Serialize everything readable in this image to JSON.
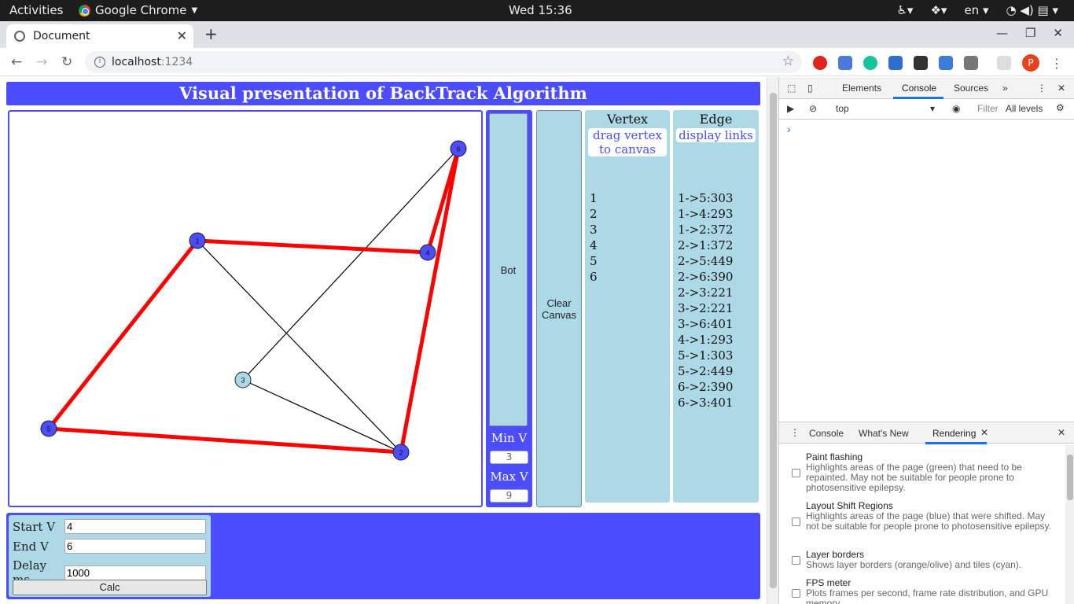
{
  "os": {
    "activities": "Activities",
    "app_name": "Google Chrome",
    "clock": "Wed 15:36",
    "language": "en"
  },
  "browser": {
    "tab_title": "Document",
    "url_host": "localhost",
    "url_port": ":1234",
    "profile_initial": "P"
  },
  "app": {
    "title": "Visual presentation of BackTrack Algorithm",
    "bot_label": "Bot",
    "min_label": "Min V",
    "min_value": "3",
    "max_label": "Max V",
    "max_value": "9",
    "clear_label": "Clear Canvas",
    "vertex_panel": {
      "title": "Vertex",
      "link": "drag vertex to canvas",
      "items": [
        "1",
        "2",
        "3",
        "4",
        "5",
        "6"
      ]
    },
    "edge_panel": {
      "title": "Edge",
      "link": "display links",
      "items": [
        "1->5:303",
        "1->4:293",
        "1->2:372",
        "2->1:372",
        "2->5:449",
        "2->6:390",
        "2->3:221",
        "3->2:221",
        "3->6:401",
        "4->1:293",
        "5->1:303",
        "5->2:449",
        "6->2:390",
        "6->3:401"
      ]
    },
    "form": {
      "start_label": "Start V",
      "start_value": "4",
      "end_label": "End V",
      "end_value": "6",
      "delay_label": "Delay ms",
      "delay_value": "1000",
      "calc_label": "Calc"
    },
    "graph": {
      "nodes": [
        {
          "id": "1",
          "color": "#4b4dff"
        },
        {
          "id": "2",
          "color": "#4b4dff"
        },
        {
          "id": "3",
          "color": "#add8e6"
        },
        {
          "id": "4",
          "color": "#4b4dff"
        },
        {
          "id": "5",
          "color": "#4b4dff"
        },
        {
          "id": "6",
          "color": "#4b4dff"
        }
      ],
      "path_color": "#ff0000",
      "edge_color": "#000000",
      "highlighted_edges": [
        [
          "5",
          "1"
        ],
        [
          "1",
          "4"
        ],
        [
          "4",
          "6"
        ],
        [
          "6",
          "2"
        ],
        [
          "2",
          "5"
        ]
      ],
      "plain_edges": [
        [
          "1",
          "2"
        ],
        [
          "3",
          "6"
        ],
        [
          "3",
          "2"
        ]
      ]
    }
  },
  "devtools": {
    "tabs": [
      "Elements",
      "Console",
      "Sources"
    ],
    "active_tab": "Console",
    "context": "top",
    "filter_placeholder": "Filter",
    "levels": "All levels",
    "drawer_tabs": [
      "Console",
      "What's New",
      "Rendering"
    ],
    "active_drawer_tab": "Rendering",
    "rendering_options": [
      {
        "title": "Paint flashing",
        "desc": "Highlights areas of the page (green) that need to be repainted. May not be suitable for people prone to photosensitive epilepsy."
      },
      {
        "title": "Layout Shift Regions",
        "desc": "Highlights areas of the page (blue) that were shifted. May not be suitable for people prone to photosensitive epilepsy."
      },
      {
        "title": "Layer borders",
        "desc": "Shows layer borders (orange/olive) and tiles (cyan)."
      },
      {
        "title": "FPS meter",
        "desc": "Plots frames per second, frame rate distribution, and GPU memory."
      }
    ]
  }
}
